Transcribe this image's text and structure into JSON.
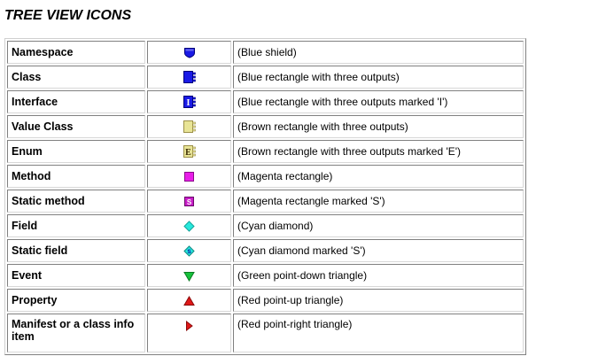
{
  "title": "TREE VIEW ICONS",
  "colors": {
    "blue": "#1a1ae6",
    "dark_blue": "#00007a",
    "tan": "#e8e496",
    "tan_dark": "#9c9048",
    "magenta": "#e81ee8",
    "cyan": "#27e8dc",
    "green": "#17c23c",
    "red": "#e01818"
  },
  "rows": [
    {
      "name": "Namespace",
      "icon": "blue-shield-icon",
      "description": "(Blue shield)"
    },
    {
      "name": "Class",
      "icon": "blue-rectangle-three-outputs-icon",
      "description": "(Blue rectangle with three outputs)"
    },
    {
      "name": "Interface",
      "icon": "blue-rectangle-three-outputs-i-icon",
      "icon_letter": "I",
      "description": "(Blue rectangle with three outputs marked 'I')"
    },
    {
      "name": "Value Class",
      "icon": "brown-rectangle-three-outputs-icon",
      "description": "(Brown rectangle with three outputs)"
    },
    {
      "name": "Enum",
      "icon": "brown-rectangle-three-outputs-e-icon",
      "icon_letter": "E",
      "description": "(Brown rectangle with three outputs marked 'E')"
    },
    {
      "name": "Method",
      "icon": "magenta-rectangle-icon",
      "description": "(Magenta rectangle)"
    },
    {
      "name": "Static method",
      "icon": "magenta-rectangle-s-icon",
      "icon_letter": "S",
      "description": "(Magenta rectangle marked 'S')"
    },
    {
      "name": "Field",
      "icon": "cyan-diamond-icon",
      "description": "(Cyan diamond)"
    },
    {
      "name": "Static field",
      "icon": "cyan-diamond-s-icon",
      "icon_letter": "S",
      "description": "(Cyan diamond marked 'S')"
    },
    {
      "name": "Event",
      "icon": "green-triangle-down-icon",
      "description": "(Green point-down triangle)"
    },
    {
      "name": "Property",
      "icon": "red-triangle-up-icon",
      "description": "(Red point-up triangle)"
    },
    {
      "name": "Manifest or a class info item",
      "icon": "red-triangle-right-icon",
      "description": "(Red point-right triangle)"
    }
  ]
}
